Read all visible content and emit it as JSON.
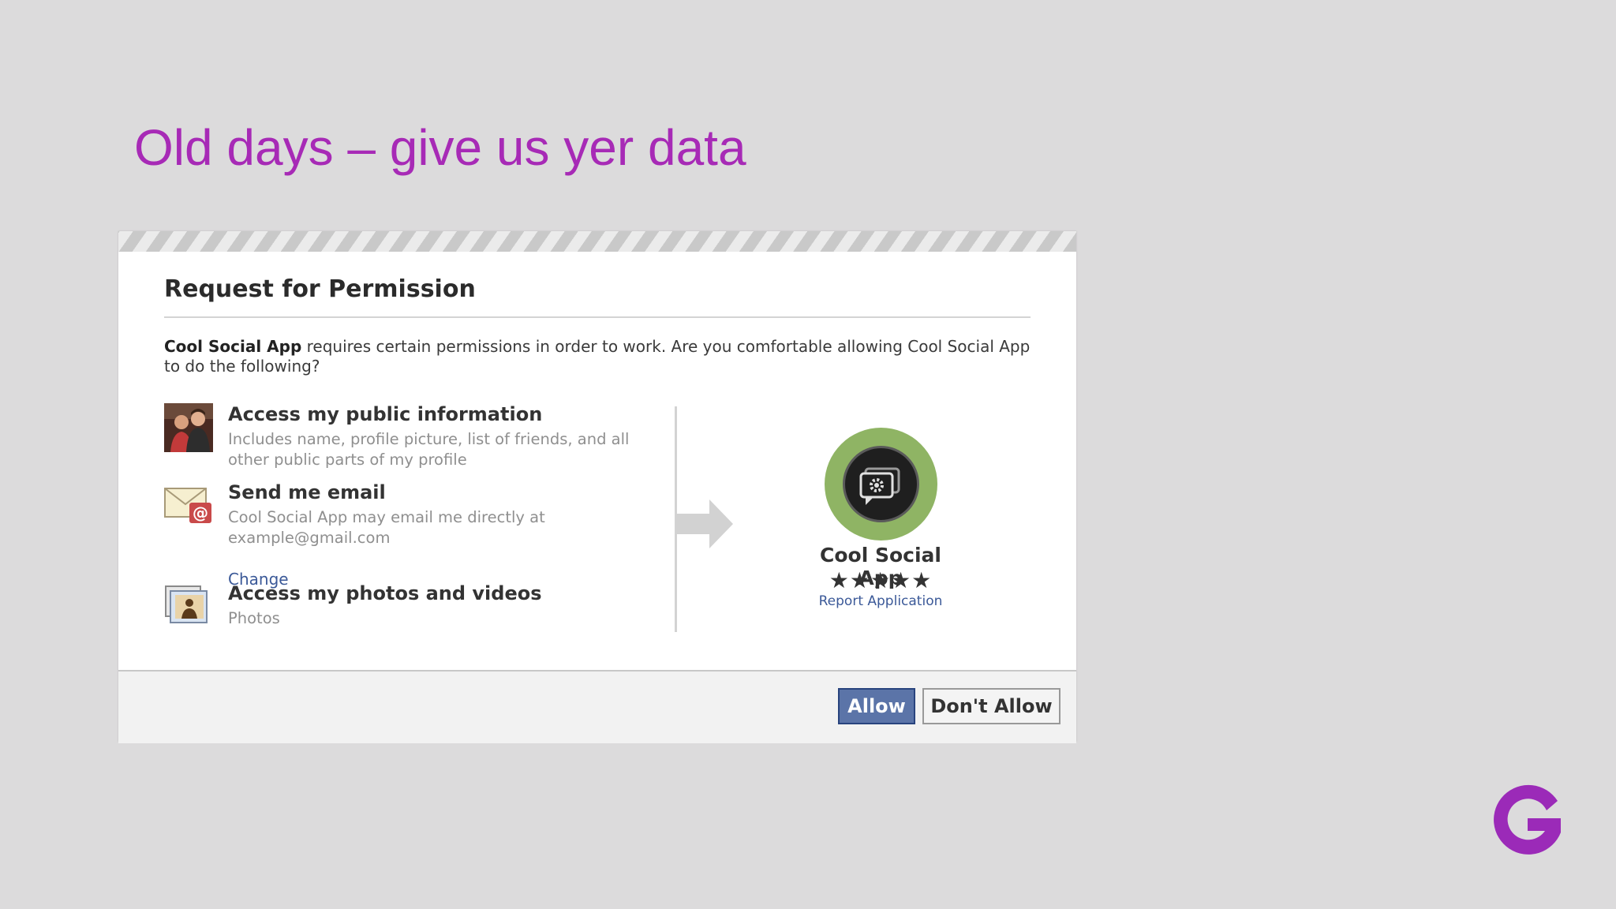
{
  "slide": {
    "title": "Old days – give us yer data"
  },
  "dialog": {
    "title": "Request for Permission",
    "intro_app_name": "Cool Social App",
    "intro_text": " requires certain permissions in order to work. Are you comfortable allowing Cool Social App to do the following?",
    "permissions": [
      {
        "icon": "profile-photo-icon",
        "title": "Access my public information",
        "description": "Includes name, profile picture, list of friends, and all other public parts of my profile"
      },
      {
        "icon": "email-envelope-icon",
        "title": "Send me email",
        "description": "Cool Social App may email me directly at example@gmail.com",
        "link": "Change"
      },
      {
        "icon": "photos-icon",
        "title": "Access my photos and videos",
        "description": "Photos"
      }
    ],
    "app": {
      "icon": "app-gear-chat-icon",
      "name": "Cool Social App",
      "rating_text": "★★★★★",
      "rating": 5,
      "report_link": "Report Application"
    },
    "buttons": {
      "allow": "Allow",
      "deny": "Don't Allow"
    }
  },
  "colors": {
    "title": "#a72ab6",
    "link": "#3b5998",
    "allow_button": "#5b74a8",
    "app_icon_ring": "#8fb464",
    "brand_logo": "#9b2ab8"
  },
  "brand": {
    "icon": "g-logo-icon"
  }
}
